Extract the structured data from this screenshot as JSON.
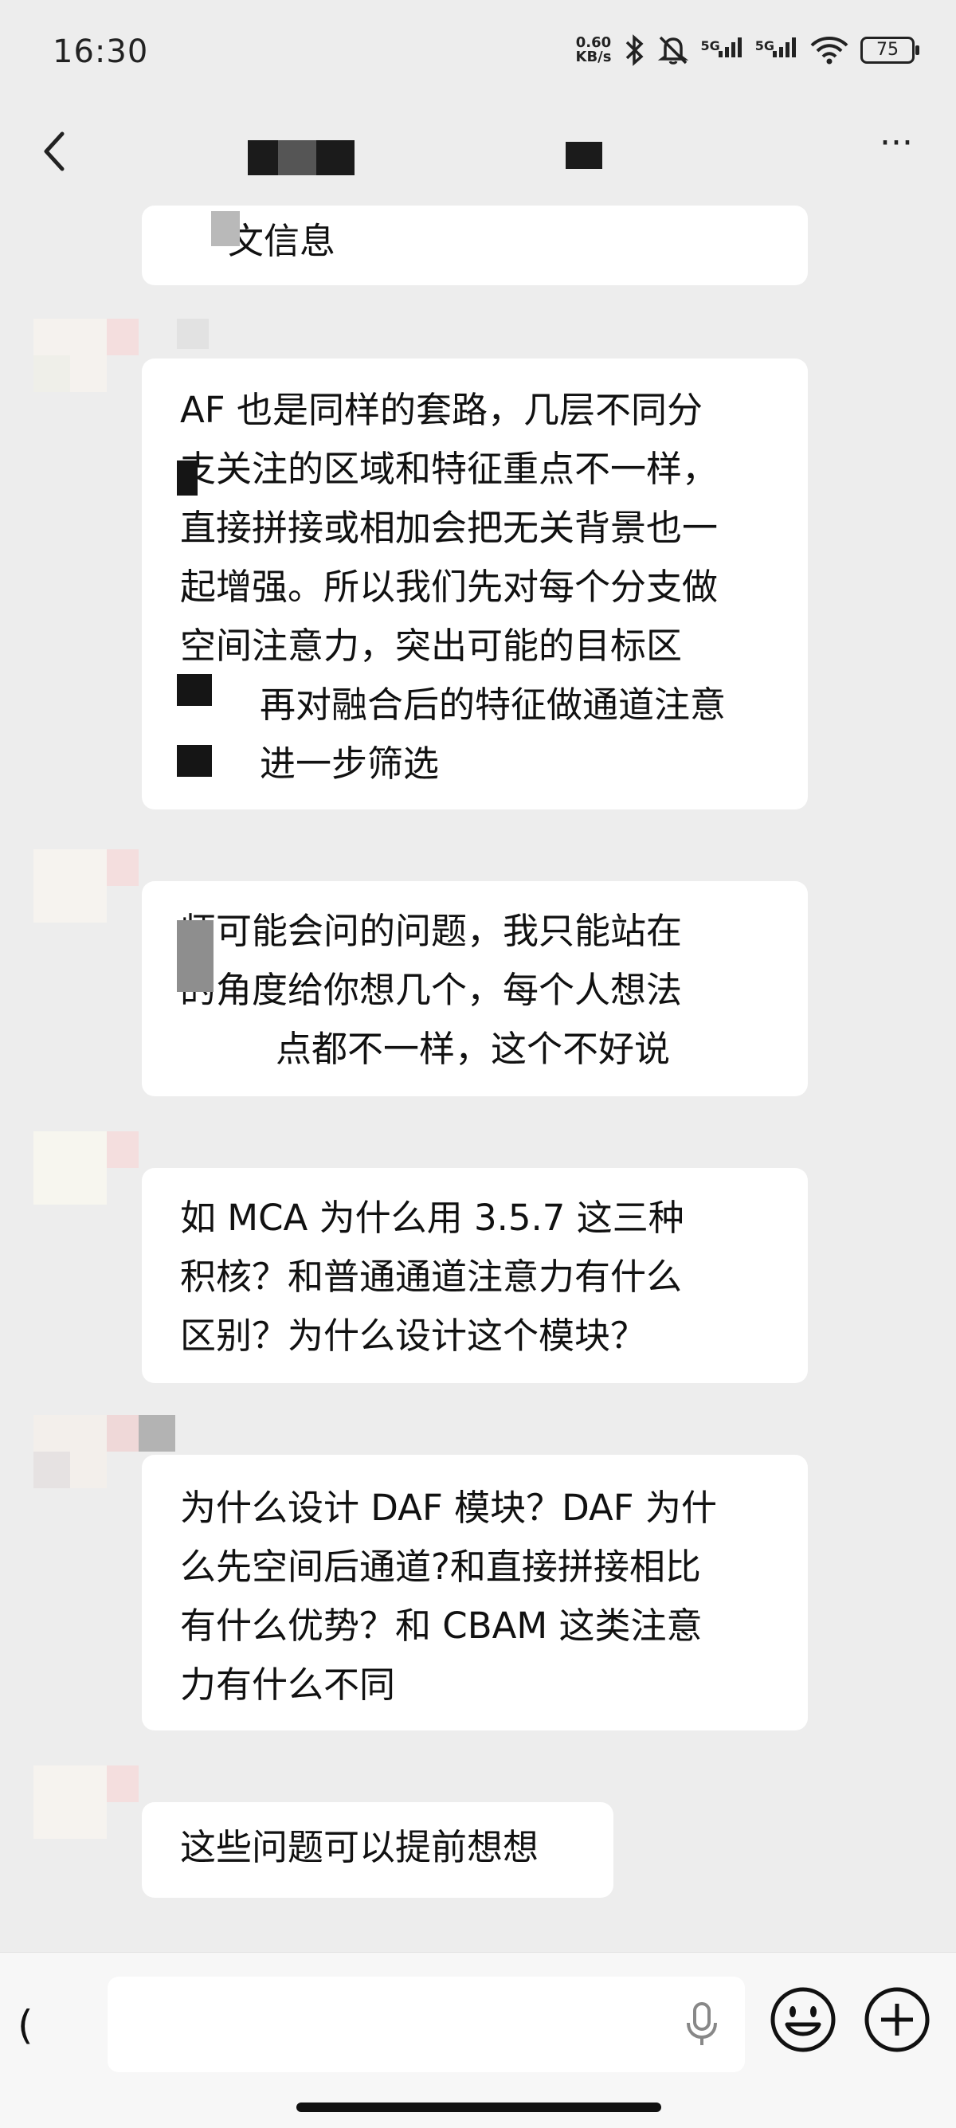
{
  "status_bar": {
    "time": "16:30",
    "net_speed_value": "0.60",
    "net_speed_unit": "KB/s",
    "signal1_label": "5G",
    "signal2_label": "5G",
    "battery_level": "75",
    "icons": [
      "bluetooth-icon",
      "mute-bell-icon",
      "signal-5g-icon",
      "signal-5g-icon",
      "wifi-icon",
      "battery-icon"
    ]
  },
  "header": {
    "back_icon": "chevron-left-icon",
    "more_icon": "more-dots-icon"
  },
  "messages": [
    {
      "lines": [
        "文信息"
      ]
    },
    {
      "lines": [
        "AF 也是同样的套路，几层不同分",
        "支关注的区域和特征重点不一样，",
        "直接拼接或相加会把无关背景也一",
        "起增强。所以我们先对每个分支做",
        "空间注意力，突出可能的目标区",
        "再对融合后的特征做通道注意",
        "进一步筛选"
      ]
    },
    {
      "lines": [
        "师可能会问的问题，我只能站在",
        "的角度给你想几个，每个人想法",
        "点都不一样，这个不好说"
      ]
    },
    {
      "lines": [
        "如 MCA 为什么用 3.5.7 这三种",
        "积核？和普通通道注意力有什么",
        "区别？为什么设计这个模块？"
      ]
    },
    {
      "lines": [
        "为什么设计 DAF 模块？DAF 为什",
        "么先空间后通道?和直接拼接相比",
        "有什么优势？和 CBAM 这类注意",
        "力有什么不同"
      ]
    },
    {
      "lines": [
        "这些问题可以提前想想"
      ]
    }
  ],
  "input_bar": {
    "input_value": "",
    "icons": [
      "voice-toggle-icon",
      "microphone-icon",
      "emoji-icon",
      "plus-icon"
    ]
  },
  "colors": {
    "background": "#ededed",
    "bubble": "#ffffff",
    "input_bar": "#f7f7f7",
    "text": "#111111"
  }
}
